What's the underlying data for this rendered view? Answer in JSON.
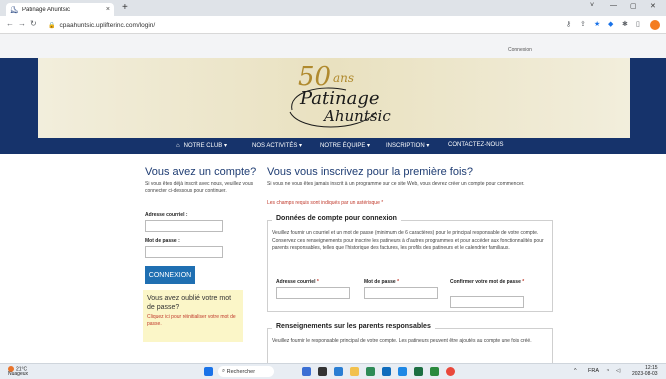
{
  "browser": {
    "tab_title": "Patinage Ahuntsic",
    "tab_close": "×",
    "new_tab": "+",
    "url": "cpaahuntsic.uplifterinc.com/login/",
    "window_controls": [
      "˅",
      "—",
      "▢",
      "✕"
    ]
  },
  "site": {
    "top_link": "Connexion",
    "logo": {
      "line1": "50",
      "line2": "ans",
      "line3": "Patinage",
      "line4": "Ahuntsic"
    },
    "nav": [
      "NOTRE CLUB ▾",
      "NOS ACTIVITÉS ▾",
      "NOTRE ÉQUIPE ▾",
      "INSCRIPTION ▾",
      "CONTACTEZ-NOUS"
    ],
    "accent_color": "#16336b"
  },
  "login": {
    "title": "Vous avez un compte?",
    "desc": "Si vous êtes déjà inscrit avec nous, veuillez vous connecter ci-dessous pour continuer.",
    "email_label": "Adresse courriel :",
    "password_label": "Mot de passe :",
    "button": "CONNEXION",
    "forgot_title": "Vous avez oublié votre mot de passe?",
    "forgot_link": "Cliquez ici pour réinitialiser votre mot de passe."
  },
  "register": {
    "title": "Vous vous inscrivez pour la première fois?",
    "desc": "Si vous ne vous êtes jamais inscrit à un programme sur ce site Web, vous devrez créer un compte pour commencer.",
    "required_note": "Les champs requis sont indiqués par un astérisque *",
    "account_legend": "Données de compte pour connexion",
    "account_desc": "Veuillez fournir un courriel et un mot de passe (minimum de 6 caractères) pour le principal responsable de votre compte. Conservez ces renseignements pour inscrire les patineurs à d'autres programmes et pour accéder aux fonctionnalités pour parents responsables, telles que l'historique des factures, les profils des patineurs et le calendrier familiaux.",
    "email_label": "Adresse courriel",
    "password_label": "Mot de passe",
    "confirm_label": "Confirmer votre mot de passe",
    "asterisk": "*",
    "parents_legend": "Renseignements sur les parents responsables",
    "parents_desc": "Veuillez fournir le responsable principal de votre compte. Les patineurs peuvent être ajoutés au compte une fois créé."
  },
  "taskbar": {
    "temp": "21°C",
    "weather": "Nuageux",
    "search": "Rechercher",
    "lang": "FRA",
    "time": "12:15",
    "date": "2023-08-03"
  }
}
